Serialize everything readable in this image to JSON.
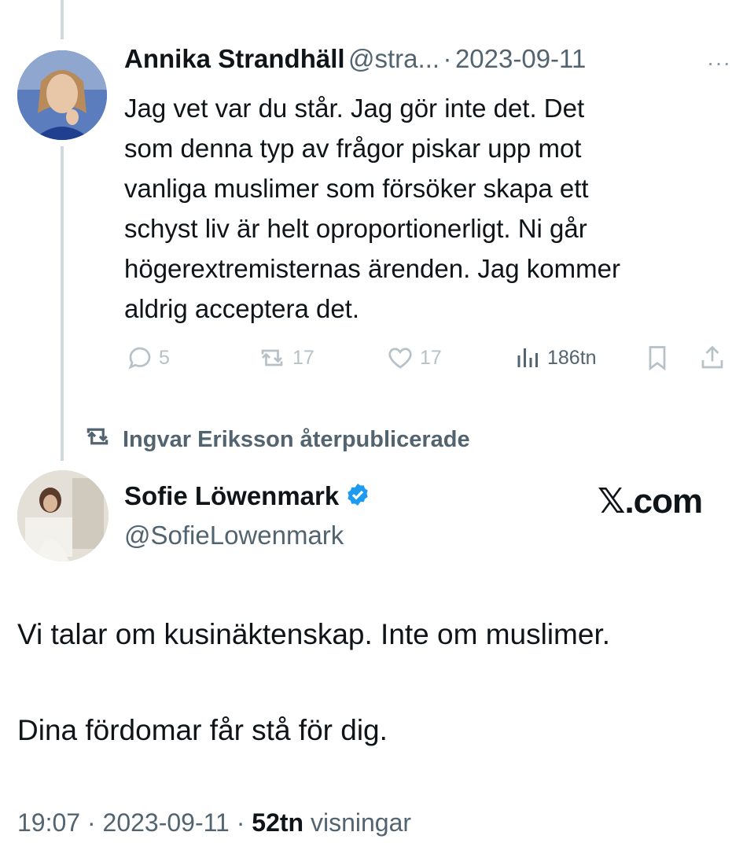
{
  "tweet1": {
    "author_name": "Annika Strandhäll",
    "handle": "@stra...",
    "separator": "·",
    "date": "2023-09-11",
    "more_label": "···",
    "body_lines": [
      "Jag vet var du står. Jag gör inte det. Det",
      "som denna typ av frågor piskar upp mot",
      "vanliga muslimer som försöker skapa ett",
      "schyst liv är helt oproportionerligt. Ni går",
      "högerextremisternas ärenden. Jag kommer",
      "aldrig acceptera det."
    ],
    "actions": {
      "replies": "5",
      "reposts": "17",
      "likes": "17",
      "views": "186tn"
    },
    "icons": [
      "reply-icon",
      "repost-icon",
      "like-icon",
      "views-icon",
      "bookmark-icon",
      "share-icon"
    ]
  },
  "repost_banner": {
    "text": "Ingvar Eriksson återpublicerade",
    "icon": "repost-icon"
  },
  "tweet2": {
    "author_name": "Sofie Löwenmark",
    "handle": "@SofieLowenmark",
    "verified_icon": "verified-badge-icon",
    "watermark": "𝕏.com",
    "body_para1": "Vi talar om kusinäktenskap. Inte om muslimer.",
    "body_para2": "Dina fördomar får stå för dig.",
    "time": "19:07",
    "sep1": " · ",
    "date": "2023-09-11",
    "sep2": " · ",
    "views_count": "52tn",
    "views_label": " visningar"
  },
  "colors": {
    "text": "#0f1419",
    "secondary": "#536471",
    "faded_action": "#b7c1c8",
    "verified": "#1d9bf0",
    "thread_line": "#cfd9de"
  }
}
